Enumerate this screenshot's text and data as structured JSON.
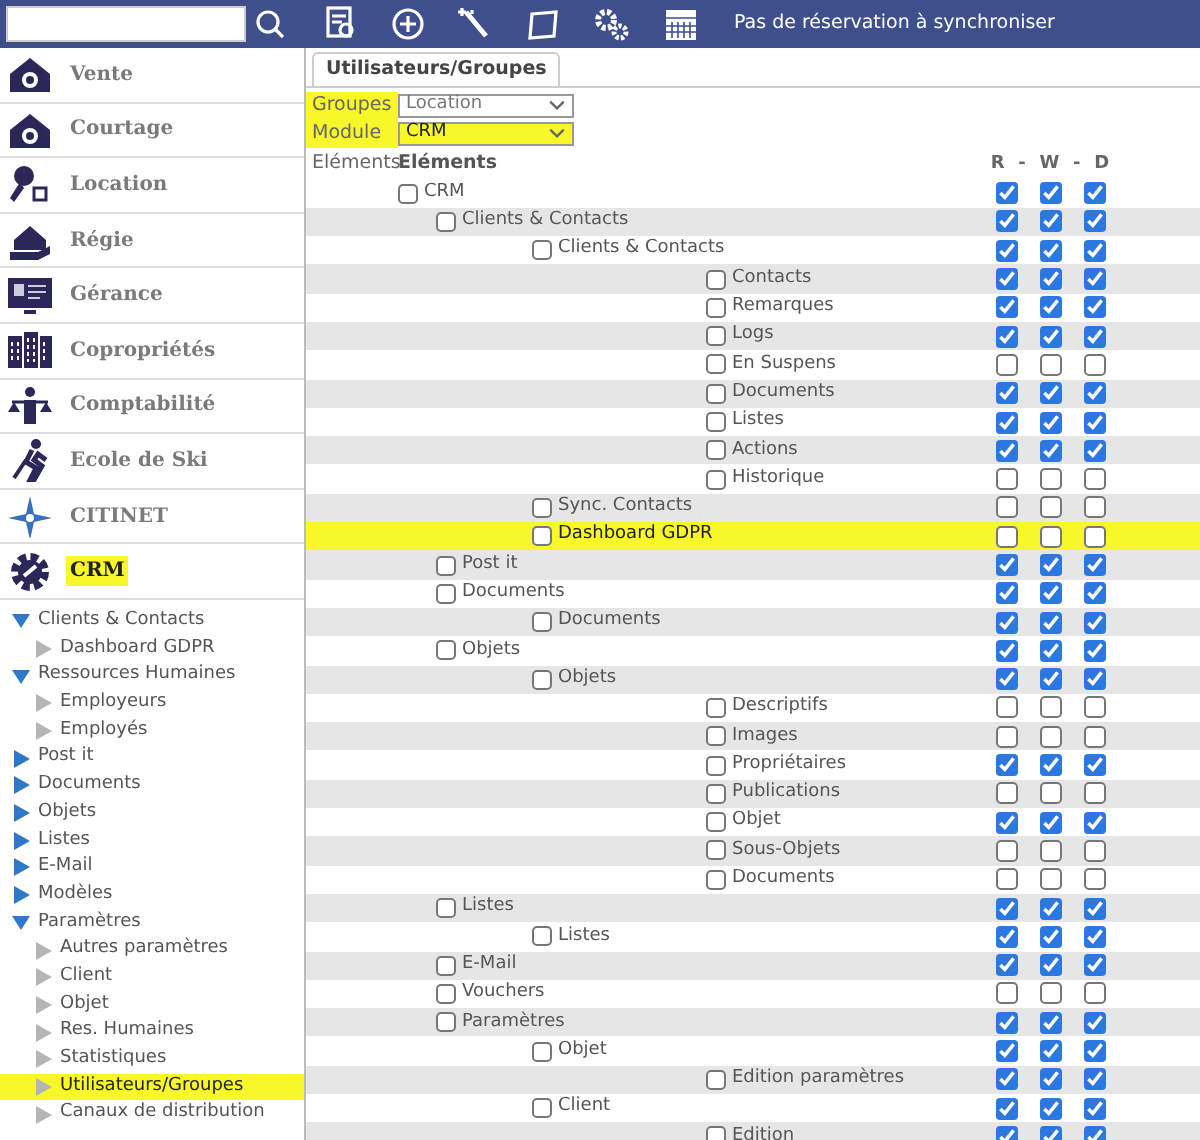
{
  "topbar": {
    "status": "Pas de réservation à synchroniser"
  },
  "modules": [
    {
      "label": "Vente",
      "highlighted": false
    },
    {
      "label": "Courtage",
      "highlighted": false
    },
    {
      "label": "Location",
      "highlighted": false
    },
    {
      "label": "Régie",
      "highlighted": false
    },
    {
      "label": "Gérance",
      "highlighted": false
    },
    {
      "label": "Copropriétés",
      "highlighted": false
    },
    {
      "label": "Comptabilité",
      "highlighted": false
    },
    {
      "label": "Ecole de Ski",
      "highlighted": false
    },
    {
      "label": "CITINET",
      "highlighted": false
    },
    {
      "label": "CRM",
      "highlighted": true
    }
  ],
  "nav": [
    {
      "label": "Clients & Contacts",
      "expanded": true,
      "selected": false,
      "highlighted": false,
      "children": [
        {
          "label": "Dashboard GDPR",
          "selected": false,
          "highlighted": false
        }
      ]
    },
    {
      "label": "Ressources Humaines",
      "expanded": true,
      "selected": false,
      "highlighted": false,
      "children": [
        {
          "label": "Employeurs",
          "selected": false,
          "highlighted": false
        },
        {
          "label": "Employés",
          "selected": false,
          "highlighted": false
        }
      ]
    },
    {
      "label": "Post it",
      "expanded": false,
      "selected": false,
      "highlighted": false
    },
    {
      "label": "Documents",
      "expanded": false,
      "selected": false,
      "highlighted": false
    },
    {
      "label": "Objets",
      "expanded": false,
      "selected": false,
      "highlighted": false
    },
    {
      "label": "Listes",
      "expanded": false,
      "selected": false,
      "highlighted": false
    },
    {
      "label": "E-Mail",
      "expanded": false,
      "selected": false,
      "highlighted": false
    },
    {
      "label": "Modèles",
      "expanded": false,
      "selected": false,
      "highlighted": false
    },
    {
      "label": "Paramètres",
      "expanded": true,
      "selected": false,
      "highlighted": false,
      "children": [
        {
          "label": "Autres paramètres",
          "selected": false,
          "highlighted": false
        },
        {
          "label": "Client",
          "selected": false,
          "highlighted": false
        },
        {
          "label": "Objet",
          "selected": false,
          "highlighted": false
        },
        {
          "label": "Res. Humaines",
          "selected": false,
          "highlighted": false
        },
        {
          "label": "Statistiques",
          "selected": false,
          "highlighted": false
        },
        {
          "label": "Utilisateurs/Groupes",
          "selected": true,
          "highlighted": true
        },
        {
          "label": "Canaux de distribution",
          "selected": false,
          "highlighted": false
        }
      ]
    }
  ],
  "tab": {
    "label": "Utilisateurs/Groupes",
    "selected": true
  },
  "filters": [
    {
      "label": "Groupes",
      "value": "Location",
      "label_highlighted": true,
      "field_highlighted": false
    },
    {
      "label": "Module",
      "value": "CRM",
      "label_highlighted": true,
      "field_highlighted": true
    }
  ],
  "table": {
    "side_label": "Eléments",
    "heading": "Eléments",
    "columns": [
      "R",
      "-",
      "W",
      "-",
      "D"
    ],
    "rows": [
      {
        "label": "CRM",
        "checked": false,
        "r": true,
        "w": true,
        "d": true,
        "highlighted": false,
        "children": [
          {
            "label": "Clients & Contacts",
            "checked": false,
            "r": true,
            "w": true,
            "d": true,
            "highlighted": false,
            "children": [
              {
                "label": "Clients & Contacts",
                "checked": false,
                "r": true,
                "w": true,
                "d": true,
                "highlighted": false,
                "children": [
                  {
                    "label": "Contacts",
                    "checked": false,
                    "r": true,
                    "w": true,
                    "d": true,
                    "highlighted": false
                  },
                  {
                    "label": "Remarques",
                    "checked": false,
                    "r": true,
                    "w": true,
                    "d": true,
                    "highlighted": false
                  },
                  {
                    "label": "Logs",
                    "checked": false,
                    "r": true,
                    "w": true,
                    "d": true,
                    "highlighted": false
                  },
                  {
                    "label": "En Suspens",
                    "checked": false,
                    "r": false,
                    "w": false,
                    "d": false,
                    "highlighted": false
                  },
                  {
                    "label": "Documents",
                    "checked": false,
                    "r": true,
                    "w": true,
                    "d": true,
                    "highlighted": false
                  },
                  {
                    "label": "Listes",
                    "checked": false,
                    "r": true,
                    "w": true,
                    "d": true,
                    "highlighted": false
                  },
                  {
                    "label": "Actions",
                    "checked": false,
                    "r": true,
                    "w": true,
                    "d": true,
                    "highlighted": false
                  },
                  {
                    "label": "Historique",
                    "checked": false,
                    "r": false,
                    "w": false,
                    "d": false,
                    "highlighted": false
                  }
                ]
              },
              {
                "label": "Sync. Contacts",
                "checked": false,
                "r": false,
                "w": false,
                "d": false,
                "highlighted": false
              },
              {
                "label": "Dashboard GDPR",
                "checked": false,
                "r": false,
                "w": false,
                "d": false,
                "highlighted": true
              }
            ]
          },
          {
            "label": "Post it",
            "checked": false,
            "r": true,
            "w": true,
            "d": true,
            "highlighted": false
          },
          {
            "label": "Documents",
            "checked": false,
            "r": true,
            "w": true,
            "d": true,
            "highlighted": false,
            "children": [
              {
                "label": "Documents",
                "checked": false,
                "r": true,
                "w": true,
                "d": true,
                "highlighted": false
              }
            ]
          },
          {
            "label": "Objets",
            "checked": false,
            "r": true,
            "w": true,
            "d": true,
            "highlighted": false,
            "children": [
              {
                "label": "Objets",
                "checked": false,
                "r": true,
                "w": true,
                "d": true,
                "highlighted": false,
                "children": [
                  {
                    "label": "Descriptifs",
                    "checked": false,
                    "r": false,
                    "w": false,
                    "d": false,
                    "highlighted": false
                  },
                  {
                    "label": "Images",
                    "checked": false,
                    "r": false,
                    "w": false,
                    "d": false,
                    "highlighted": false
                  },
                  {
                    "label": "Propriétaires",
                    "checked": false,
                    "r": true,
                    "w": true,
                    "d": true,
                    "highlighted": false
                  },
                  {
                    "label": "Publications",
                    "checked": false,
                    "r": false,
                    "w": false,
                    "d": false,
                    "highlighted": false
                  },
                  {
                    "label": "Objet",
                    "checked": false,
                    "r": true,
                    "w": true,
                    "d": true,
                    "highlighted": false
                  },
                  {
                    "label": "Sous-Objets",
                    "checked": false,
                    "r": false,
                    "w": false,
                    "d": false,
                    "highlighted": false
                  },
                  {
                    "label": "Documents",
                    "checked": false,
                    "r": false,
                    "w": false,
                    "d": false,
                    "highlighted": false
                  }
                ]
              }
            ]
          },
          {
            "label": "Listes",
            "checked": false,
            "r": true,
            "w": true,
            "d": true,
            "highlighted": false,
            "children": [
              {
                "label": "Listes",
                "checked": false,
                "r": true,
                "w": true,
                "d": true,
                "highlighted": false
              }
            ]
          },
          {
            "label": "E-Mail",
            "checked": false,
            "r": true,
            "w": true,
            "d": true,
            "highlighted": false
          },
          {
            "label": "Vouchers",
            "checked": false,
            "r": false,
            "w": false,
            "d": false,
            "highlighted": false
          },
          {
            "label": "Paramètres",
            "checked": false,
            "r": true,
            "w": true,
            "d": true,
            "highlighted": false,
            "children": [
              {
                "label": "Objet",
                "checked": false,
                "r": true,
                "w": true,
                "d": true,
                "highlighted": false,
                "children": [
                  {
                    "label": "Edition paramètres",
                    "checked": false,
                    "r": true,
                    "w": true,
                    "d": true,
                    "highlighted": false
                  }
                ]
              },
              {
                "label": "Client",
                "checked": false,
                "r": true,
                "w": true,
                "d": true,
                "highlighted": false,
                "children": [
                  {
                    "label": "Edition",
                    "checked": false,
                    "r": true,
                    "w": true,
                    "d": true,
                    "highlighted": false
                  }
                ]
              }
            ]
          }
        ]
      }
    ]
  }
}
